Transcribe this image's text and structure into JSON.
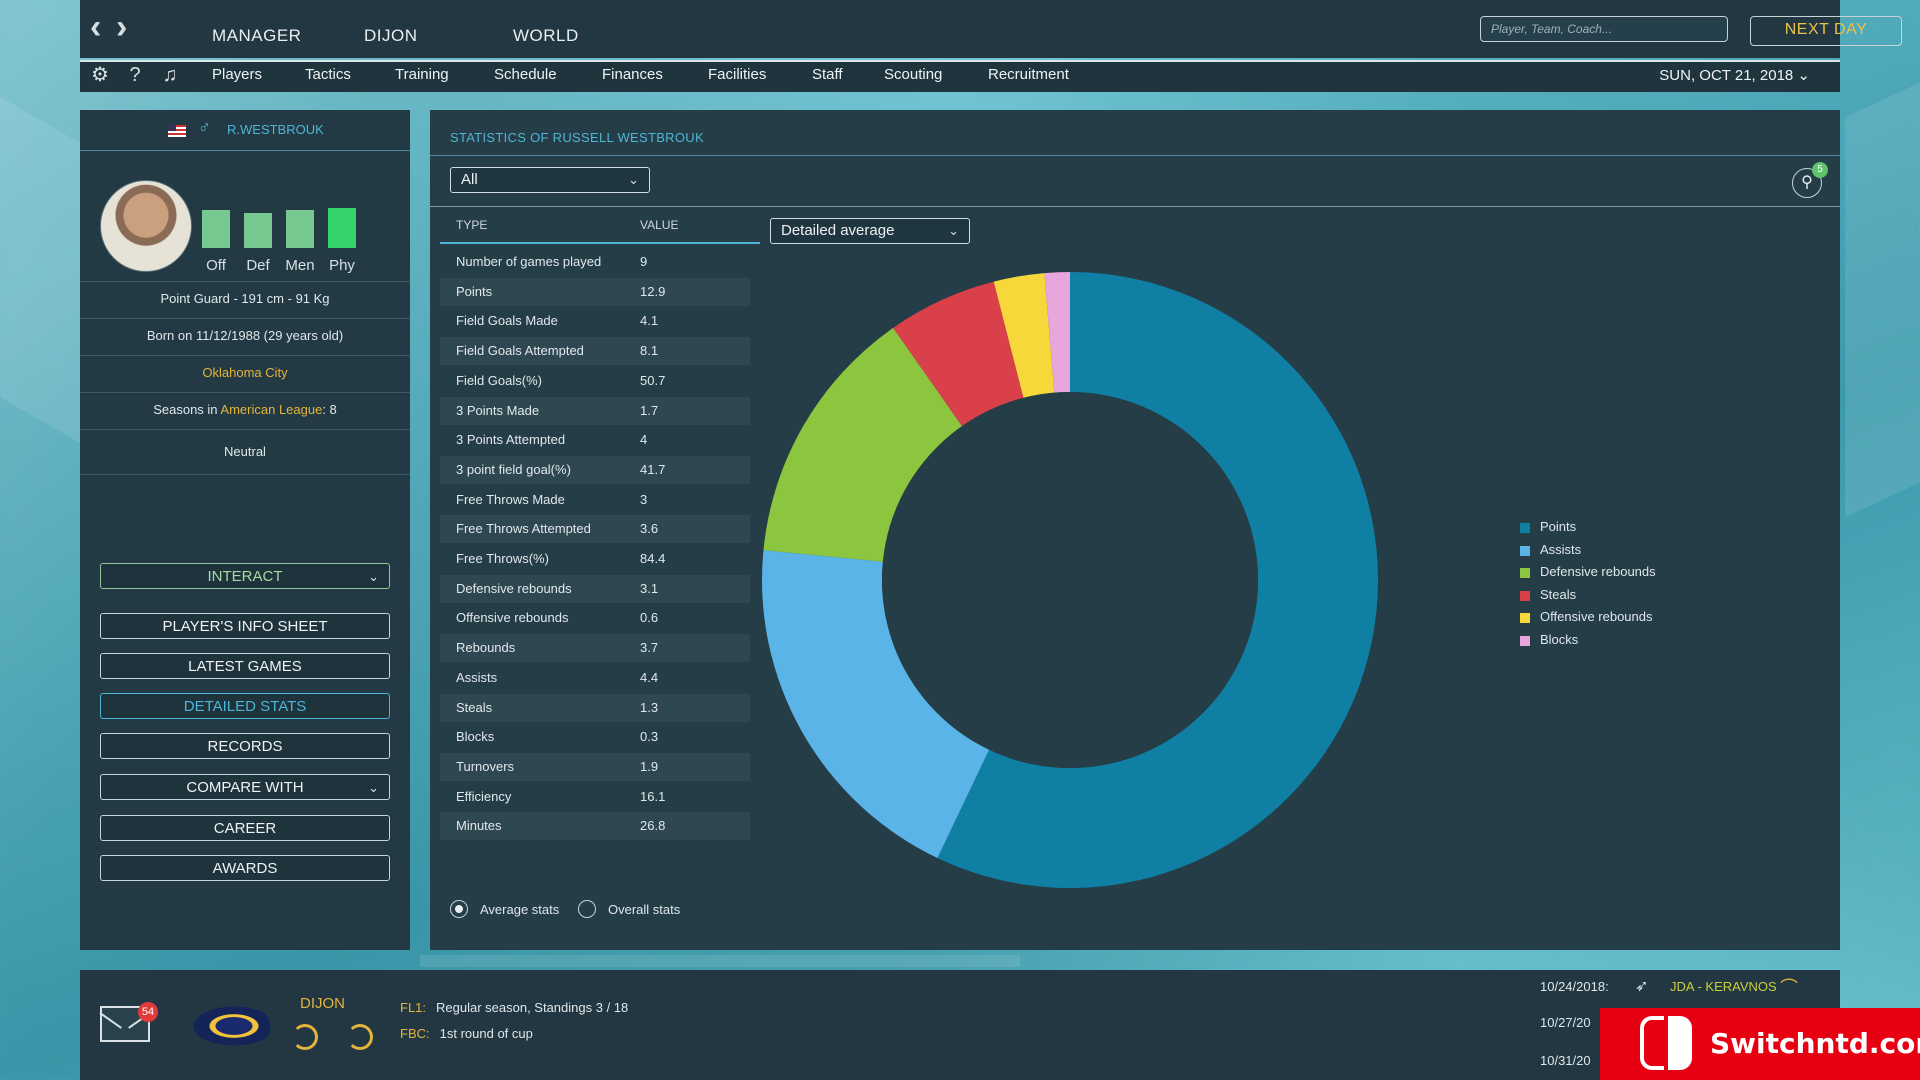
{
  "top_nav": {
    "items": [
      "MANAGER",
      "DIJON",
      "WORLD"
    ],
    "search_placeholder": "Player, Team, Coach...",
    "next_day": "NEXT DAY"
  },
  "sub_nav": {
    "items": [
      "Players",
      "Tactics",
      "Training",
      "Schedule",
      "Finances",
      "Facilities",
      "Staff",
      "Scouting",
      "Recruitment"
    ],
    "date": "SUN, OCT 21, 2018"
  },
  "player": {
    "name": "R.WESTBROUK",
    "ratings": [
      {
        "label": "Off",
        "level": 0.75
      },
      {
        "label": "Def",
        "level": 0.7
      },
      {
        "label": "Men",
        "level": 0.75
      },
      {
        "label": "Phy",
        "level": 0.8
      }
    ],
    "position_line": "Point Guard - 191 cm - 91 Kg",
    "born_line": "Born on 11/12/1988 (29 years old)",
    "team": "Oklahoma City",
    "seasons_prefix": "Seasons in ",
    "league": "American League",
    "seasons_suffix": ": 8",
    "mood": "Neutral"
  },
  "left_menu": {
    "interact": "INTERACT",
    "buttons": [
      "PLAYER'S INFO SHEET",
      "LATEST GAMES",
      "DETAILED STATS",
      "RECORDS"
    ],
    "compare": "COMPARE WITH",
    "buttons2": [
      "CAREER",
      "AWARDS"
    ]
  },
  "stats": {
    "title": "STATISTICS OF RUSSELL WESTBROUK",
    "filter_select": "All",
    "chart_select": "Detailed average",
    "filter_badge": "5",
    "col_type": "TYPE",
    "col_value": "VALUE",
    "rows": [
      {
        "type": "Number of games played",
        "value": "9"
      },
      {
        "type": "Points",
        "value": "12.9"
      },
      {
        "type": "Field Goals Made",
        "value": "4.1"
      },
      {
        "type": "Field Goals Attempted",
        "value": "8.1"
      },
      {
        "type": "Field Goals(%)",
        "value": "50.7"
      },
      {
        "type": "3 Points Made",
        "value": "1.7"
      },
      {
        "type": "3 Points Attempted",
        "value": "4"
      },
      {
        "type": "3 point field goal(%)",
        "value": "41.7"
      },
      {
        "type": "Free Throws Made",
        "value": "3"
      },
      {
        "type": "Free Throws Attempted",
        "value": "3.6"
      },
      {
        "type": "Free Throws(%)",
        "value": "84.4"
      },
      {
        "type": "Defensive rebounds",
        "value": "3.1"
      },
      {
        "type": "Offensive rebounds",
        "value": "0.6"
      },
      {
        "type": "Rebounds",
        "value": "3.7"
      },
      {
        "type": "Assists",
        "value": "4.4"
      },
      {
        "type": "Steals",
        "value": "1.3"
      },
      {
        "type": "Blocks",
        "value": "0.3"
      },
      {
        "type": "Turnovers",
        "value": "1.9"
      },
      {
        "type": "Efficiency",
        "value": "16.1"
      },
      {
        "type": "Minutes",
        "value": "26.8"
      }
    ],
    "radio_average": "Average stats",
    "radio_overall": "Overall stats"
  },
  "chart_data": {
    "type": "pie",
    "categories": [
      "Points",
      "Assists",
      "Defensive rebounds",
      "Steals",
      "Offensive rebounds",
      "Blocks"
    ],
    "values": [
      12.9,
      4.4,
      3.1,
      1.3,
      0.6,
      0.3
    ],
    "colors": [
      "#0f7fa3",
      "#5ab4e8",
      "#8cc63f",
      "#d9404a",
      "#f7d83a",
      "#e7a6dc"
    ],
    "legend_position": "right"
  },
  "bottom": {
    "mail_count": "54",
    "team": "DIJON",
    "comps": [
      {
        "code": "FL1:",
        "text": "Regular season, Standings 3 / 18"
      },
      {
        "code": "FBC:",
        "text": "1st round of cup"
      }
    ],
    "fixtures": [
      {
        "date": "10/24/2018:",
        "match": "JDA - KERAVNOS"
      },
      {
        "date": "10/27/20"
      },
      {
        "date": "10/31/20"
      }
    ]
  },
  "watermark": "Switchntd.com"
}
